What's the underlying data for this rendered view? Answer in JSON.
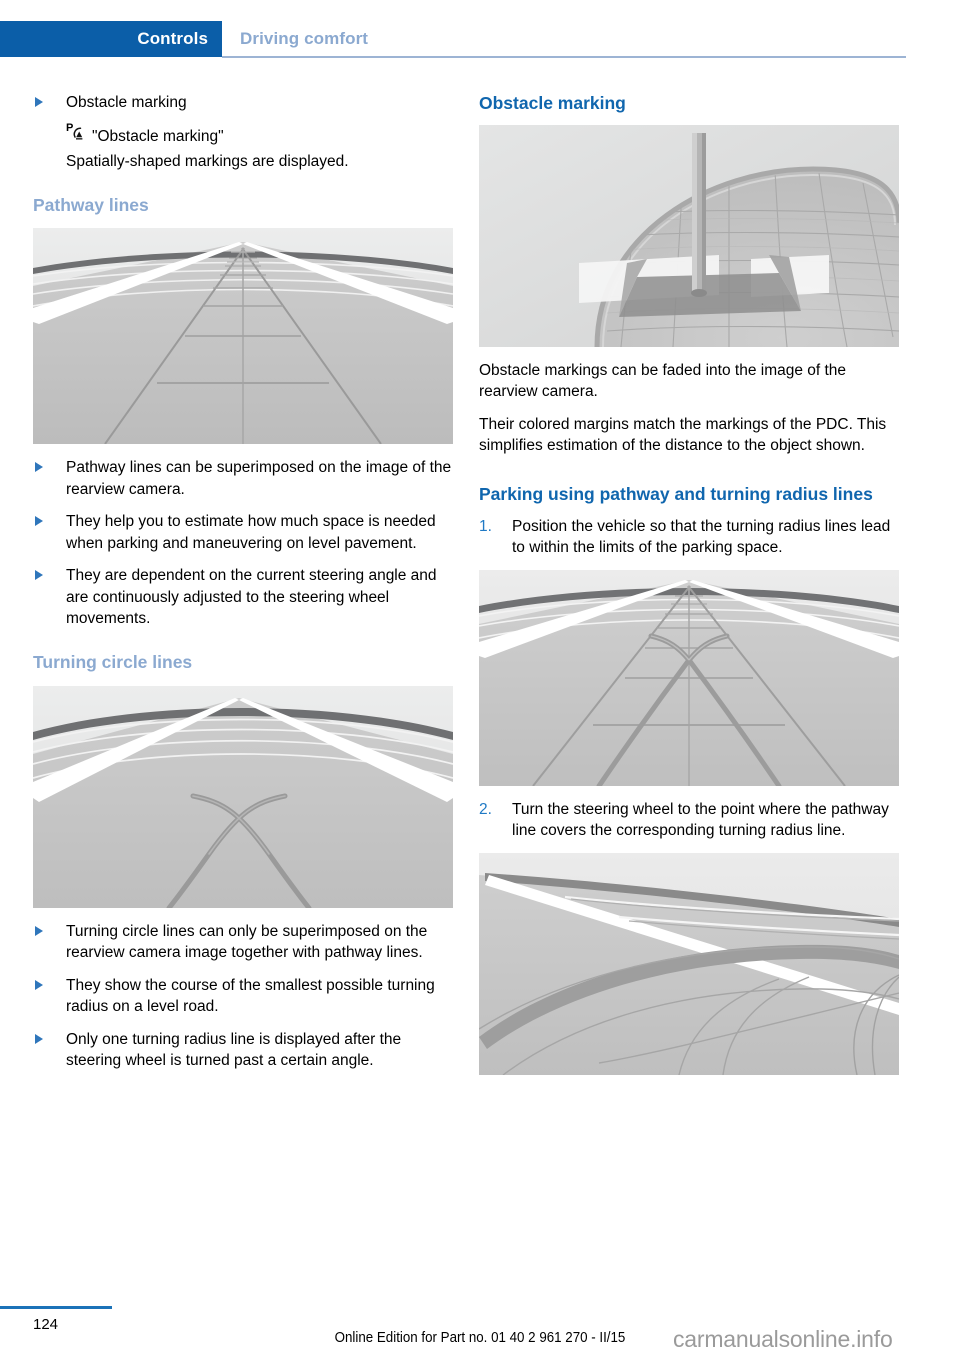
{
  "header": {
    "active_tab": "Controls",
    "inactive_tab": "Driving comfort",
    "active_color": "#0b5ea8",
    "inactive_color": "#8ba9d0"
  },
  "left_column": {
    "intro_bullet": "Obstacle marking",
    "menu_item": "\"Obstacle marking\"",
    "menu_icon": "pdc-icon",
    "menu_description": "Spatially-shaped markings are displayed.",
    "heading_pathway": "Pathway lines",
    "figure_pathway_caption": "Rearview camera image with superimposed pathway lines",
    "pathway_bullets": [
      "Pathway lines can be superimposed on the image of the rearview camera.",
      "They help you to estimate how much space is needed when parking and maneuvering on level pavement.",
      "They are dependent on the current steering angle and are continuously adjusted to the steering wheel movements."
    ],
    "heading_turning": "Turning circle lines",
    "figure_turning_caption": "Rearview camera image with turning circle lines",
    "turning_bullets": [
      "Turning circle lines can only be superimposed on the rearview camera image together with pathway lines.",
      "They show the course of the smallest possible turning radius on a level road.",
      "Only one turning radius line is displayed after the steering wheel is turned past a certain angle."
    ]
  },
  "right_column": {
    "heading_obstacle": "Obstacle marking",
    "figure_obstacle_caption": "Rearview camera image showing an obstacle marking around a pole",
    "obstacle_paragraphs": [
      "Obstacle markings can be faded into the image of the rearview camera.",
      "Their colored margins match the markings of the PDC. This simplifies estimation of the distance to the object shown."
    ],
    "heading_parking": "Parking using pathway and turning radius lines",
    "steps": [
      {
        "number": "1.",
        "text": "Position the vehicle so that the turning radius lines lead to within the limits of the parking space."
      },
      {
        "number": "2.",
        "text": "Turn the steering wheel to the point where the pathway line covers the corresponding turning radius line."
      }
    ],
    "figure_step1_caption": "Rearview camera image with pathway and turning radius lines overlaid",
    "figure_step2_caption": "Rearview camera image with pathway line covering the turning radius line"
  },
  "footer": {
    "page_number": "124",
    "edition": "Online Edition for Part no. 01 40 2 961 270 - II/15",
    "watermark": "carmanualsonline.info"
  },
  "colors": {
    "brand_blue": "#0b5ea8",
    "heading_blue": "#1066ae",
    "subheading_blue": "#8ba9d0",
    "bullet_blue": "#2f76bb",
    "rule_blue": "#1b72b8"
  }
}
